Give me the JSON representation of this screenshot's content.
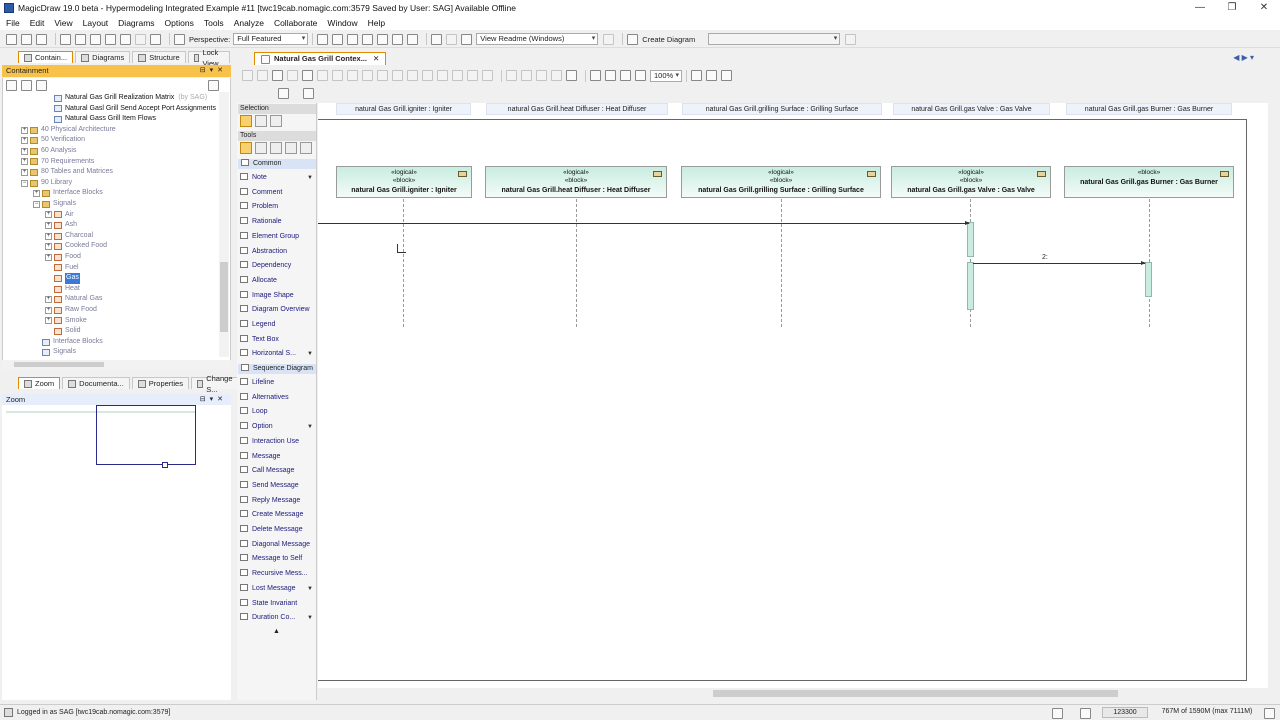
{
  "window": {
    "title": "MagicDraw 19.0 beta - Hypermodeling Integrated Example #11 [twc19cab.nomagic.com:3579 Saved by User: SAG]  Available Offline",
    "controls": [
      "—",
      "❐",
      "✕"
    ]
  },
  "menu": [
    "File",
    "Edit",
    "View",
    "Layout",
    "Diagrams",
    "Options",
    "Tools",
    "Analyze",
    "Collaborate",
    "Window",
    "Help"
  ],
  "toolbar": {
    "perspective_label": "Perspective:",
    "perspective_value": "Full Featured",
    "view_readme": "View Readme (Windows)",
    "create_diagram": "Create Diagram"
  },
  "left_tabs": [
    "Contain...",
    "Diagrams",
    "Structure",
    "Lock View"
  ],
  "containment": {
    "header": "Containment",
    "tree": [
      {
        "label": "Natural Gas Grill Realization Matrix",
        "extra": "(by SAG)",
        "icon": "diag",
        "indent": 3,
        "dark": true,
        "exp": ""
      },
      {
        "label": "Natural Gasl Grill Send Accept Port Assignments",
        "icon": "diag",
        "indent": 3,
        "dark": true,
        "exp": ""
      },
      {
        "label": "Natural Gass Grill Item Flows",
        "icon": "diag",
        "indent": 3,
        "dark": true,
        "exp": ""
      },
      {
        "label": "40 Physical Architecture",
        "icon": "folder",
        "indent": 1,
        "exp": "+"
      },
      {
        "label": "50 Verification",
        "icon": "folder",
        "indent": 1,
        "exp": "+"
      },
      {
        "label": "60 Analysis",
        "icon": "folder",
        "indent": 1,
        "exp": "+"
      },
      {
        "label": "70 Requirements",
        "icon": "folder",
        "indent": 1,
        "exp": "+"
      },
      {
        "label": "80 Tables and Matrices",
        "icon": "folder",
        "indent": 1,
        "exp": "+"
      },
      {
        "label": "90 Library",
        "icon": "folder",
        "indent": 1,
        "exp": "−"
      },
      {
        "label": "Interface Blocks",
        "icon": "folder",
        "indent": 2,
        "exp": "+"
      },
      {
        "label": "Signals",
        "icon": "folder",
        "indent": 2,
        "exp": "−"
      },
      {
        "label": "Air",
        "icon": "sig",
        "indent": 3,
        "exp": "+"
      },
      {
        "label": "Ash",
        "icon": "sig",
        "indent": 3,
        "exp": "+"
      },
      {
        "label": "Charcoal",
        "icon": "sig",
        "indent": 3,
        "exp": "+"
      },
      {
        "label": "Cooked Food",
        "icon": "sig",
        "indent": 3,
        "exp": "+"
      },
      {
        "label": "Food",
        "icon": "sig",
        "indent": 3,
        "exp": "+"
      },
      {
        "label": "Fuel",
        "icon": "sig",
        "indent": 3,
        "exp": ""
      },
      {
        "label": "Gas",
        "icon": "sig",
        "indent": 3,
        "exp": "",
        "selected": true
      },
      {
        "label": "Heat",
        "icon": "sig",
        "indent": 3,
        "exp": ""
      },
      {
        "label": "Natural Gas",
        "icon": "sig",
        "indent": 3,
        "exp": "+"
      },
      {
        "label": "Raw Food",
        "icon": "sig",
        "indent": 3,
        "exp": "+"
      },
      {
        "label": "Smoke",
        "icon": "sig",
        "indent": 3,
        "exp": "+"
      },
      {
        "label": "Solid",
        "icon": "sig",
        "indent": 3,
        "exp": ""
      },
      {
        "label": "Interface Blocks",
        "icon": "diag",
        "indent": 2,
        "exp": ""
      },
      {
        "label": "Signals",
        "icon": "diag",
        "indent": 2,
        "exp": ""
      }
    ]
  },
  "bottom_tabs": [
    "Zoom",
    "Documenta...",
    "Properties",
    "Change S..."
  ],
  "zoom_panel": {
    "header": "Zoom"
  },
  "editor": {
    "tab_label": "Natural Gas Grill Contex...",
    "tab_close": "✕",
    "zoom_level": "100%"
  },
  "palette": {
    "selection": "Selection",
    "tools": "Tools",
    "common": "Common",
    "common_items": [
      {
        "label": "Note",
        "dd": true
      },
      {
        "label": "Comment"
      },
      {
        "label": "Problem"
      },
      {
        "label": "Rationale"
      },
      {
        "label": "Element Group"
      },
      {
        "label": "Abstraction"
      },
      {
        "label": "Dependency"
      },
      {
        "label": "Allocate"
      },
      {
        "label": "Image Shape"
      },
      {
        "label": "Diagram Overview"
      },
      {
        "label": "Legend"
      },
      {
        "label": "Text Box"
      },
      {
        "label": "Horizontal S...",
        "dd": true
      }
    ],
    "sequence": "Sequence Diagram",
    "sequence_items": [
      {
        "label": "Lifeline"
      },
      {
        "label": "Alternatives"
      },
      {
        "label": "Loop"
      },
      {
        "label": "Option",
        "dd": true
      },
      {
        "label": "Interaction Use"
      },
      {
        "label": "Message"
      },
      {
        "label": "Call Message"
      },
      {
        "label": "Send Message"
      },
      {
        "label": "Reply Message"
      },
      {
        "label": "Create Message"
      },
      {
        "label": "Delete Message"
      },
      {
        "label": "Diagonal Message"
      },
      {
        "label": "Message to Self"
      },
      {
        "label": "Recursive Mess..."
      },
      {
        "label": "Lost Message",
        "dd": true
      },
      {
        "label": "State Invariant"
      },
      {
        "label": "Duration Co...",
        "dd": true
      }
    ],
    "collapse": "▲"
  },
  "diagram": {
    "column_headers": [
      "natural Gas Grill.igniter : Igniter",
      "natural Gas Grill.heat Diffuser : Heat Diffuser",
      "natural Gas Grill.grilling Surface : Grilling Surface",
      "natural Gas Grill.gas Valve : Gas Valve",
      "natural Gas Grill.gas Burner : Gas Burner"
    ],
    "lifelines": [
      {
        "stereotypes": [
          "«logical»",
          "«block»"
        ],
        "name": "natural Gas Grill.igniter : Igniter"
      },
      {
        "stereotypes": [
          "«logical»",
          "«block»"
        ],
        "name": "natural Gas Grill.heat Diffuser : Heat Diffuser"
      },
      {
        "stereotypes": [
          "«logical»",
          "«block»"
        ],
        "name": "natural Gas Grill.grilling Surface : Grilling Surface"
      },
      {
        "stereotypes": [
          "«logical»",
          "«block»"
        ],
        "name": "natural Gas Grill.gas Valve : Gas Valve"
      },
      {
        "stereotypes": [
          "«block»"
        ],
        "name": "natural Gas Grill.gas Burner : Gas Burner"
      }
    ],
    "messages": [
      {
        "label": ""
      },
      {
        "label": "2:"
      }
    ]
  },
  "status": {
    "login": "Logged in as SAG [twc19cab.nomagic.com:3579]",
    "coords": "123300",
    "memory": "767M of 1590M (max 7111M)"
  }
}
